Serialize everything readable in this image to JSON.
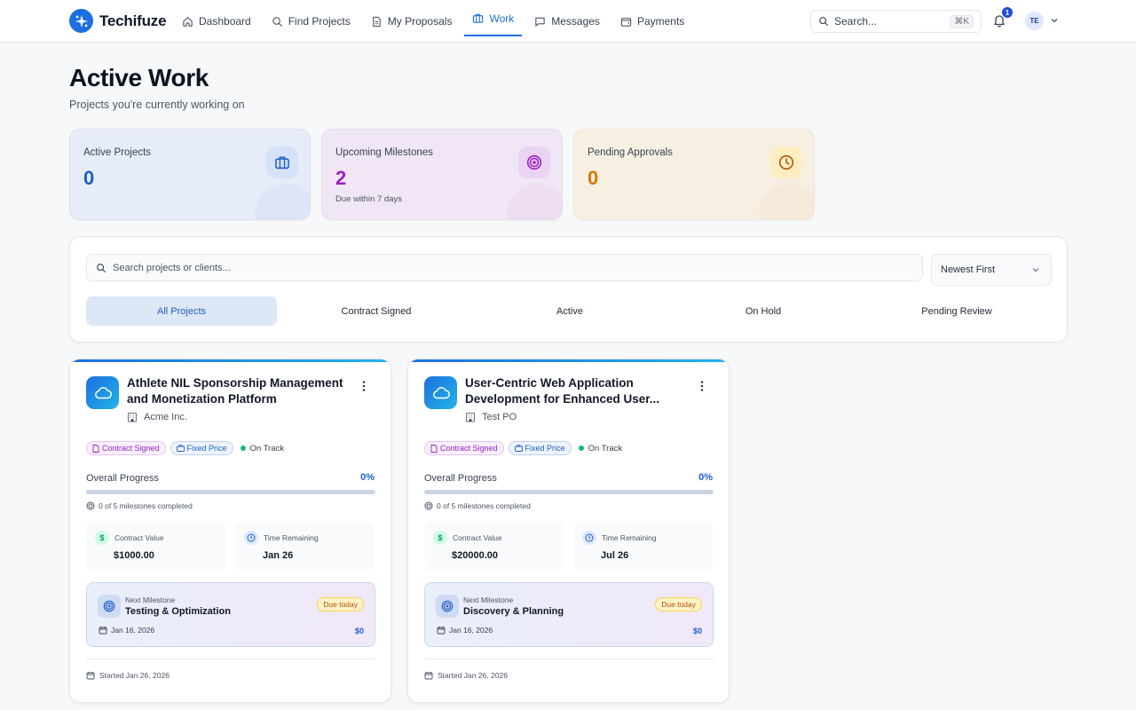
{
  "app": {
    "name": "Techifuze"
  },
  "nav": [
    {
      "label": "Dashboard",
      "icon": "home-icon",
      "active": false
    },
    {
      "label": "Find Projects",
      "icon": "search-icon",
      "active": false
    },
    {
      "label": "My Proposals",
      "icon": "document-icon",
      "active": false
    },
    {
      "label": "Work",
      "icon": "briefcase-icon",
      "active": true
    },
    {
      "label": "Messages",
      "icon": "message-icon",
      "active": false
    },
    {
      "label": "Payments",
      "icon": "wallet-icon",
      "active": false
    }
  ],
  "topbar": {
    "search_placeholder": "Search...",
    "shortcut": "⌘K",
    "notification_count": "1",
    "avatar_initials": "TE"
  },
  "header": {
    "title": "Active Work",
    "subtitle": "Projects you're currently working on"
  },
  "stats": [
    {
      "label": "Active Projects",
      "value": "0",
      "note": "",
      "icon": "briefcase-icon"
    },
    {
      "label": "Upcoming Milestones",
      "value": "2",
      "note": "Due within 7 days",
      "icon": "target-icon"
    },
    {
      "label": "Pending Approvals",
      "value": "0",
      "note": "",
      "icon": "clock-icon"
    }
  ],
  "filters": {
    "search_placeholder": "Search projects or clients...",
    "sort_selected": "Newest First",
    "tabs": [
      "All Projects",
      "Contract Signed",
      "Active",
      "On Hold",
      "Pending Review"
    ],
    "active_tab": "All Projects"
  },
  "projects": [
    {
      "title": "Athlete NIL Sponsorship Management and Monetization Platform",
      "client": "Acme Inc.",
      "chips": {
        "status": "Contract Signed",
        "type": "Fixed Price",
        "health": "On Track"
      },
      "progress_label": "Overall Progress",
      "progress_pct": "0%",
      "progress_value": 0,
      "milestones_text": "0 of 5 milestones completed",
      "contract_value_label": "Contract Value",
      "contract_value": "$1000.00",
      "time_remaining_label": "Time Remaining",
      "time_remaining": "Jan 26",
      "next_milestone_label": "Next Milestone",
      "next_milestone": "Testing & Optimization",
      "due_badge": "Due today",
      "next_date": "Jan 16, 2026",
      "next_amount": "$0",
      "started": "Started Jan 26, 2026"
    },
    {
      "title": "User-Centric Web Application Development for Enhanced User...",
      "client": "Test PO",
      "chips": {
        "status": "Contract Signed",
        "type": "Fixed Price",
        "health": "On Track"
      },
      "progress_label": "Overall Progress",
      "progress_pct": "0%",
      "progress_value": 0,
      "milestones_text": "0 of 5 milestones completed",
      "contract_value_label": "Contract Value",
      "contract_value": "$20000.00",
      "time_remaining_label": "Time Remaining",
      "time_remaining": "Jul 26",
      "next_milestone_label": "Next Milestone",
      "next_milestone": "Discovery & Planning",
      "due_badge": "Due today",
      "next_date": "Jan 16, 2026",
      "next_amount": "$0",
      "started": "Started Jan 26, 2026"
    }
  ],
  "colors": {
    "primary": "#1d6fe0",
    "purple": "#9b1fc6",
    "amber": "#d97706",
    "success": "#10b981"
  }
}
